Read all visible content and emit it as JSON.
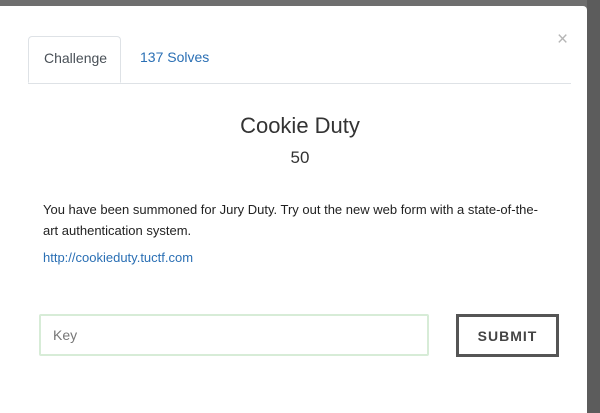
{
  "tabs": [
    {
      "label": "Challenge",
      "active": true
    },
    {
      "label": "137 Solves",
      "active": false
    }
  ],
  "close_symbol": "×",
  "challenge": {
    "name": "Cookie Duty",
    "value": "50",
    "description": "You have been summoned for Jury Duty. Try out the new web form with a state-of-the-art authentication system.",
    "link": "http://cookieduty.tuctf.com"
  },
  "form": {
    "key_placeholder": "Key",
    "key_value": "",
    "submit_label": "SUBMIT"
  },
  "colors": {
    "link": "#2a6fb4",
    "input_border": "#d7ecd7",
    "button_border": "#555555"
  }
}
